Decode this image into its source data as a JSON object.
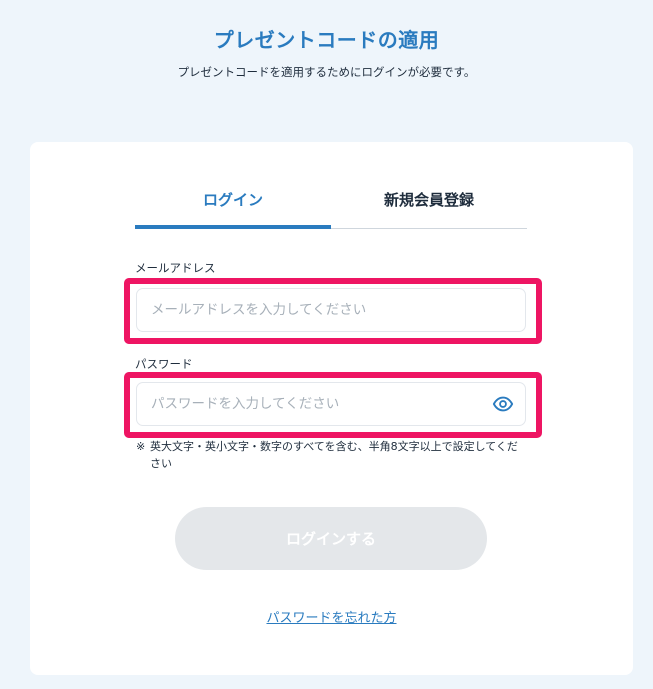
{
  "header": {
    "title": "プレゼントコードの適用",
    "subtitle": "プレゼントコードを適用するためにログインが必要です。"
  },
  "tabs": [
    {
      "label": "ログイン",
      "active": true
    },
    {
      "label": "新規会員登録",
      "active": false
    }
  ],
  "form": {
    "email": {
      "label": "メールアドレス",
      "placeholder": "メールアドレスを入力してください",
      "value": ""
    },
    "password": {
      "label": "パスワード",
      "placeholder": "パスワードを入力してください",
      "value": "",
      "toggle_icon": "eye-icon"
    },
    "note_mark": "※",
    "note": "英大文字・英小文字・数字のすべてを含む、半角8文字以上で設定してください",
    "submit_label": "ログインする",
    "submit_enabled": false,
    "forgot_label": "パスワードを忘れた方"
  },
  "colors": {
    "accent": "#2a7bbf",
    "highlight": "#ee1563",
    "page_background": "#eef5fb",
    "disabled_button": "#e4e7ea"
  }
}
